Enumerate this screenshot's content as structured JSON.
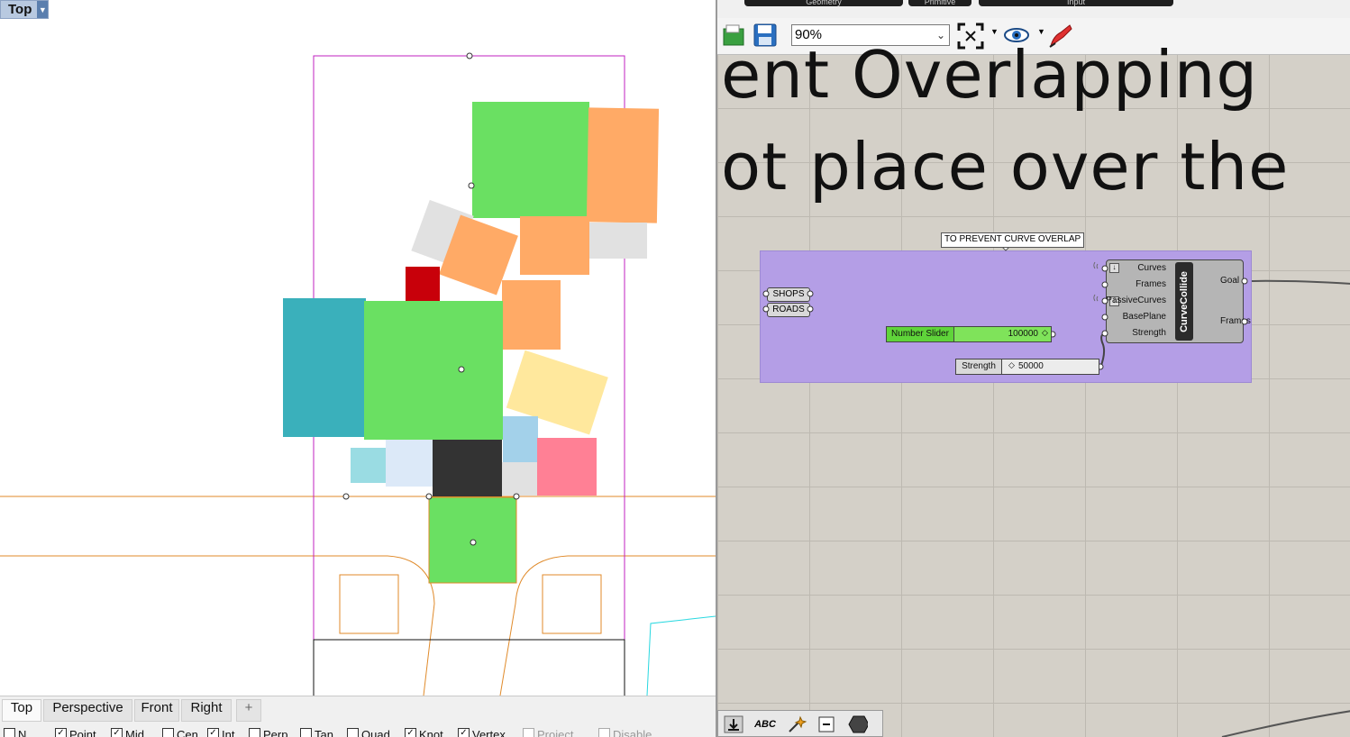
{
  "viewport": {
    "label": "Top",
    "tabs": [
      "Top",
      "Perspective",
      "Front",
      "Right"
    ],
    "add_tab": "+",
    "snaps": [
      {
        "label": "N",
        "checked": false
      },
      {
        "label": "Point",
        "checked": true
      },
      {
        "label": "Mid",
        "checked": true
      },
      {
        "label": "Cen",
        "checked": false
      },
      {
        "label": "Int",
        "checked": true
      },
      {
        "label": "Perp",
        "checked": false
      },
      {
        "label": "Tan",
        "checked": false
      },
      {
        "label": "Quad",
        "checked": false
      },
      {
        "label": "Knot",
        "checked": true
      },
      {
        "label": "Vertex",
        "checked": true
      },
      {
        "label": "Project",
        "checked": false
      },
      {
        "label": "Disable",
        "checked": false
      }
    ]
  },
  "grasshopper": {
    "top_tabs": [
      "Geometry",
      "Primitive",
      "Input"
    ],
    "zoom": "90%",
    "big_text_line1": "ent Overlapping",
    "big_text_line2": "ot place over the",
    "group_label": "TO PREVENT CURVE OVERLAP",
    "params": {
      "shops": "SHOPS",
      "roads": "ROADS"
    },
    "slider1": {
      "label": "Number Slider",
      "value": "100000"
    },
    "slider2": {
      "label": "Strength",
      "value": "50000"
    },
    "component": {
      "name": "CurveCollide",
      "inputs": [
        "Curves",
        "Frames",
        "PassiveCurves",
        "BasePlane",
        "Strength"
      ],
      "outputs": [
        "Goal",
        "Frames"
      ]
    },
    "colors": {
      "group": "#b49ee6",
      "slider_green": "#5fd43a",
      "canvas": "#d4d0c8"
    }
  }
}
